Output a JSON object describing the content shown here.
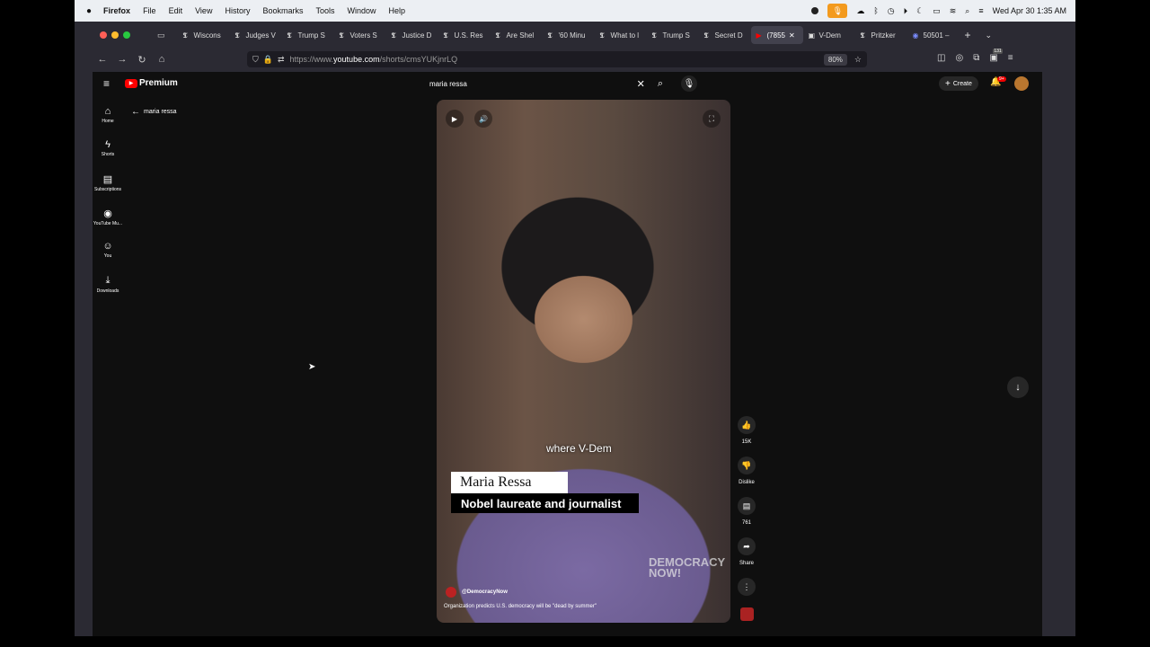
{
  "menubar": {
    "app_name": "Firefox",
    "menus": [
      "File",
      "Edit",
      "View",
      "History",
      "Bookmarks",
      "Tools",
      "Window",
      "Help"
    ],
    "clock": "Wed Apr 30  1:35 AM"
  },
  "tabs": [
    {
      "label": "Wiscons"
    },
    {
      "label": "Judges V"
    },
    {
      "label": "Trump S"
    },
    {
      "label": "Voters S"
    },
    {
      "label": "Justice D"
    },
    {
      "label": "U.S. Res"
    },
    {
      "label": "Are Shel"
    },
    {
      "label": "'60 Minu"
    },
    {
      "label": "What to l"
    },
    {
      "label": "Trump S"
    },
    {
      "label": "Secret D"
    },
    {
      "label": "(7855"
    },
    {
      "label": "V-Dem"
    },
    {
      "label": "Pritzker"
    },
    {
      "label": "50501 –"
    }
  ],
  "url": {
    "prefix": "https://www.",
    "host": "youtube.com",
    "path": "/shorts/cmsYUKjnrLQ"
  },
  "zoom": "80%",
  "extension_badge": "131",
  "youtube": {
    "logo_text": "Premium",
    "search_value": "maria ressa",
    "back_label": "maria ressa",
    "create_label": "Create",
    "notif_badge": "9+",
    "sidebar": [
      {
        "label": "Home",
        "icon": "home-icon"
      },
      {
        "label": "Shorts",
        "icon": "shorts-icon"
      },
      {
        "label": "Subscriptions",
        "icon": "subscriptions-icon"
      },
      {
        "label": "YouTube Mu...",
        "icon": "music-icon"
      },
      {
        "label": "You",
        "icon": "you-icon"
      },
      {
        "label": "Downloads",
        "icon": "download-icon"
      }
    ],
    "short": {
      "caption": "where V-Dem",
      "name_plate": "Maria Ressa",
      "title_plate": "Nobel laureate and journalist",
      "watermark": "DEMOCRACY NOW!",
      "channel": "@DemocracyNow",
      "description": "Organization predicts U.S. democracy will be \"dead by summer\""
    },
    "actions": {
      "likes": "15K",
      "dislike": "Dislike",
      "comments": "761",
      "share": "Share"
    }
  }
}
